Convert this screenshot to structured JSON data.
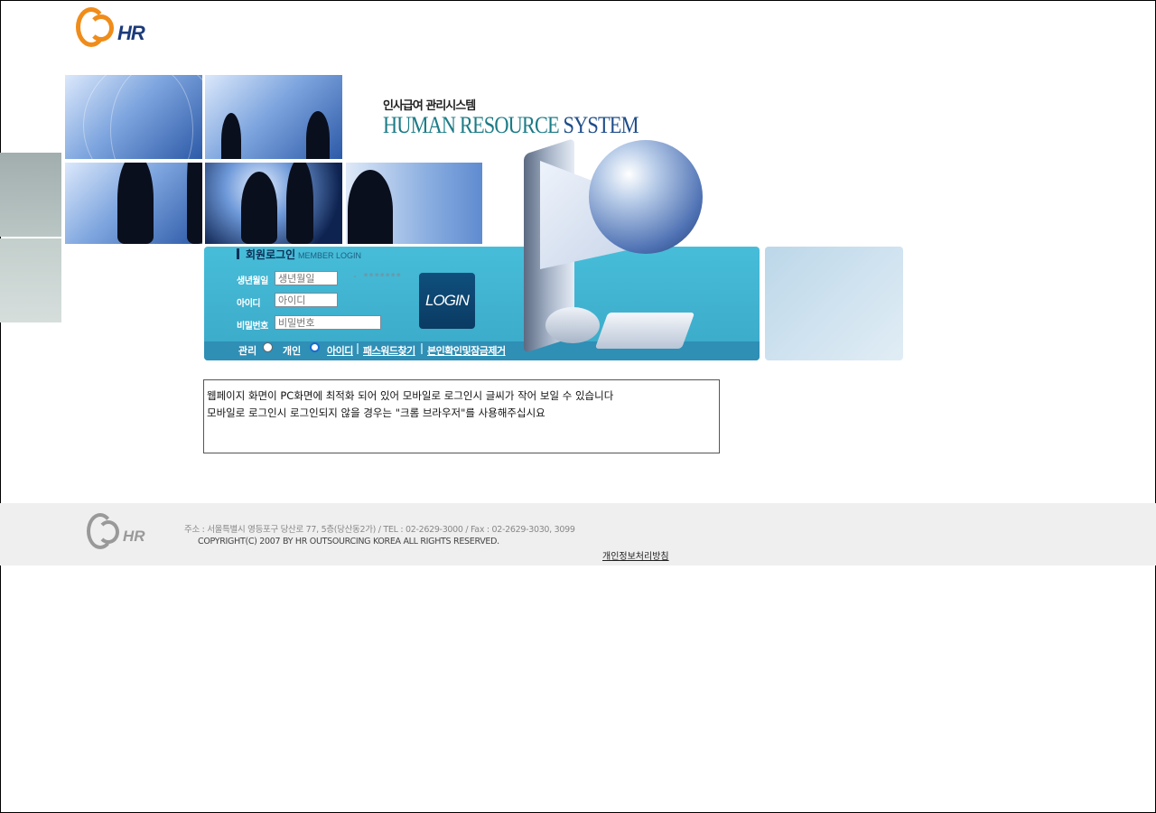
{
  "logo": {
    "text": "HR"
  },
  "title": {
    "korean": "인사급여 관리시스템",
    "english_main": "HUMAN RESOURCE",
    "english_sys": "SYSTEM"
  },
  "login": {
    "heading": "회원로그인",
    "heading_en": "MEMBER LOGIN",
    "birth_label": "생년월일",
    "birth_placeholder": "생년월일",
    "birth_mask": "- *******",
    "id_label": "아이디",
    "id_placeholder": "아이디",
    "pw_label": "비밀번호",
    "pw_placeholder": "비밀번호",
    "login_button": "LOGIN",
    "radio_admin": "관리",
    "radio_personal": "개인",
    "selected": "개인",
    "link_id": "아이디",
    "link_password": "패스워드찾기",
    "link_unlock": "본인확인및잠금제거"
  },
  "notice": {
    "line1": "웹페이지 화면이 PC화면에 최적화 되어 있어 모바일로 로그인시 글씨가 작어 보일 수 있습니다",
    "line2": "모바일로 로그인시 로그인되지 않을 경우는 \"크롬 브라우저\"를 사용해주십시요"
  },
  "footer": {
    "address": "주소 : 서울특별시 영등포구 당산로 77, 5층(당산동2가) / TEL : 02-2629-3000 / Fax : 02-2629-3030, 3099",
    "copyright": "COPYRIGHT(C)  2007 BY HR OUTSOURCING KOREA ALL RIGHTS RESERVED.",
    "privacy_link": "개인정보처리방침"
  },
  "colors": {
    "panel": "#47bdd9",
    "logo_orange": "#f08c1a",
    "title_teal": "#1b7b86",
    "login_button": "#0f4f7d"
  }
}
